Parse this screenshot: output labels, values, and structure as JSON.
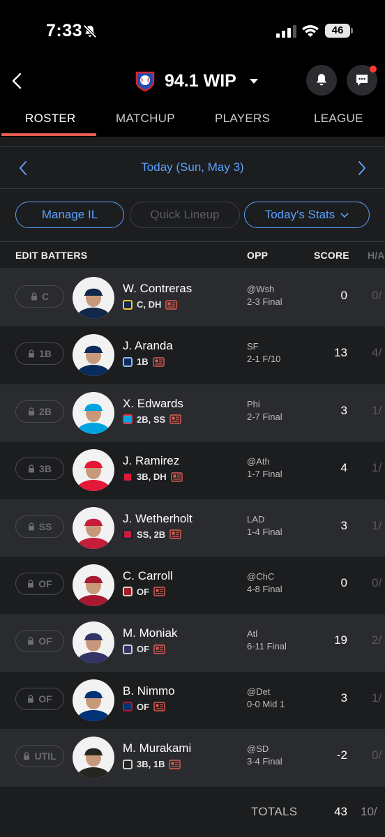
{
  "status": {
    "time": "7:33",
    "battery": "46"
  },
  "header": {
    "league_name": "94.1 WIP"
  },
  "tabs": [
    {
      "label": "ROSTER"
    },
    {
      "label": "MATCHUP"
    },
    {
      "label": "PLAYERS"
    },
    {
      "label": "LEAGUE"
    }
  ],
  "date": {
    "label": "Today (Sun, May 3)"
  },
  "actions": {
    "manage_il": "Manage IL",
    "quick_lineup": "Quick Lineup",
    "stats_view": "Today's Stats"
  },
  "table": {
    "headers": {
      "edit": "EDIT BATTERS",
      "opp": "OPP",
      "score": "SCORE",
      "ha": "H/A"
    },
    "rows": [
      {
        "slot": "C",
        "name": "W. Contreras",
        "positions": "C, DH",
        "opp": "@Wsh",
        "result": "2-3 Final",
        "score": "0",
        "ha": "0/",
        "team_color": "#12284b",
        "team_accent": "#ffc52f"
      },
      {
        "slot": "1B",
        "name": "J. Aranda",
        "positions": "1B",
        "opp": "SF",
        "result": "2-1 F/10",
        "score": "13",
        "ha": "4/",
        "team_color": "#092c5c",
        "team_accent": "#8fbce6"
      },
      {
        "slot": "2B",
        "name": "X. Edwards",
        "positions": "2B, SS",
        "opp": "Phi",
        "result": "2-7 Final",
        "score": "3",
        "ha": "1/",
        "team_color": "#00a3e0",
        "team_accent": "#ef3340"
      },
      {
        "slot": "3B",
        "name": "J. Ramirez",
        "positions": "3B, DH",
        "opp": "@Ath",
        "result": "1-7 Final",
        "score": "4",
        "ha": "1/",
        "team_color": "#e31937",
        "team_accent": "#0c2340"
      },
      {
        "slot": "SS",
        "name": "J. Wetherholt",
        "positions": "SS, 2B",
        "opp": "LAD",
        "result": "1-4 Final",
        "score": "3",
        "ha": "1/",
        "team_color": "#c41e3a",
        "team_accent": "#0c2340"
      },
      {
        "slot": "OF",
        "name": "C. Carroll",
        "positions": "OF",
        "opp": "@ChC",
        "result": "4-8 Final",
        "score": "0",
        "ha": "0/",
        "team_color": "#a71930",
        "team_accent": "#e3d4ad"
      },
      {
        "slot": "OF",
        "name": "M. Moniak",
        "positions": "OF",
        "opp": "Atl",
        "result": "6-11 Final",
        "score": "19",
        "ha": "2/",
        "team_color": "#333366",
        "team_accent": "#c4ced4"
      },
      {
        "slot": "OF",
        "name": "B. Nimmo",
        "positions": "OF",
        "opp": "@Det",
        "result": "0-0 Mid 1",
        "score": "3",
        "ha": "1/",
        "team_color": "#003278",
        "team_accent": "#c0111f"
      },
      {
        "slot": "UTIL",
        "name": "M. Murakami",
        "positions": "3B, 1B",
        "opp": "@SD",
        "result": "3-4 Final",
        "score": "-2",
        "ha": "0/",
        "team_color": "#27251f",
        "team_accent": "#c4ced4"
      }
    ]
  },
  "totals": {
    "label": "TOTALS",
    "score": "43",
    "ha": "10/"
  },
  "colors": {
    "accent_blue": "#5aa2ff",
    "tab_underline": "#e25c52",
    "notification": "#ff3b30",
    "news_icon": "#e25c52"
  }
}
